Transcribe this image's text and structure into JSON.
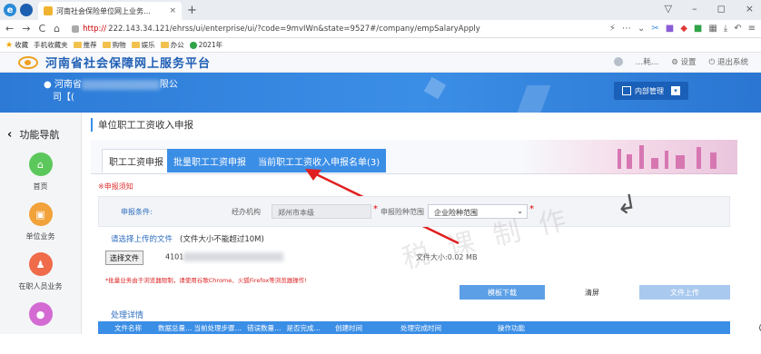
{
  "browser": {
    "tab_title": "河南社会保险单位网上业务…",
    "tab_close": "×",
    "new_tab": "+",
    "url_scheme": "http://",
    "url_rest": "222.143.34.121/ehrss/ui/enterprise/ui/?code=9mvIWn&state=9527#/company/empSalaryApply",
    "win_controls": [
      "▽",
      "–",
      "◻",
      "×"
    ],
    "nav": [
      "←",
      "→",
      "C",
      "⌂"
    ],
    "bookmarks": [
      "收藏",
      "手机收藏夹",
      "推荐",
      "购物",
      "娱乐",
      "办公",
      "2021年"
    ]
  },
  "site": {
    "title": "河南省社会保障网上服务平台",
    "top_links": [
      "…耗…",
      "设置",
      "退出系统"
    ],
    "company_line1": "河南省",
    "company_line1_tail": "限公",
    "company_line2": "司【(",
    "inner_mgmt": "内部管理"
  },
  "sidebar": {
    "title": "功能导航",
    "items": [
      {
        "label": "首页",
        "color": "#5cc85c",
        "icon": "home-icon"
      },
      {
        "label": "单位业务",
        "color": "#f2a23a",
        "icon": "building-icon"
      },
      {
        "label": "在职人员业务",
        "color": "#ef6b4a",
        "icon": "person-icon"
      },
      {
        "label": "",
        "color": "#d36bd3",
        "icon": "person2-icon"
      }
    ]
  },
  "content": {
    "page_title": "单位职工工资收入申报",
    "tabs": [
      "职工工资申报",
      "批量职工工资申报",
      "当前职工工资收入申报名单(3)"
    ],
    "notice": "※申报须知",
    "condition_label": "申报条件:",
    "org_label": "经办机构",
    "org_value": "郑州市本级",
    "range_label": "申报险种范围",
    "range_value": "企业险种范围",
    "upload_label": "请选择上传的文件",
    "upload_hint": "(文件大小不能超过10M)",
    "file_button": "选择文件",
    "file_name_prefix": "4101",
    "file_size": "文件大小:0.02 MB",
    "warning": "*批量业务由于浏览器限制，请使用谷歌Chrome、火狐Firefox等浏览器操作!",
    "btn_download": "模板下载",
    "btn_clear": "清屏",
    "btn_upload": "文件上传",
    "detail_title": "处理详情",
    "table_headers": [
      "文件名称",
      "数据总量…",
      "当前处理步骤…",
      "错误数量…",
      "是否完成…",
      "创建时间",
      "处理完成时间",
      "操作功能"
    ]
  },
  "overlay": {
    "watermark": "税 课 制 作",
    "logo_text": "税课",
    "arrow_color": "#e02020"
  }
}
